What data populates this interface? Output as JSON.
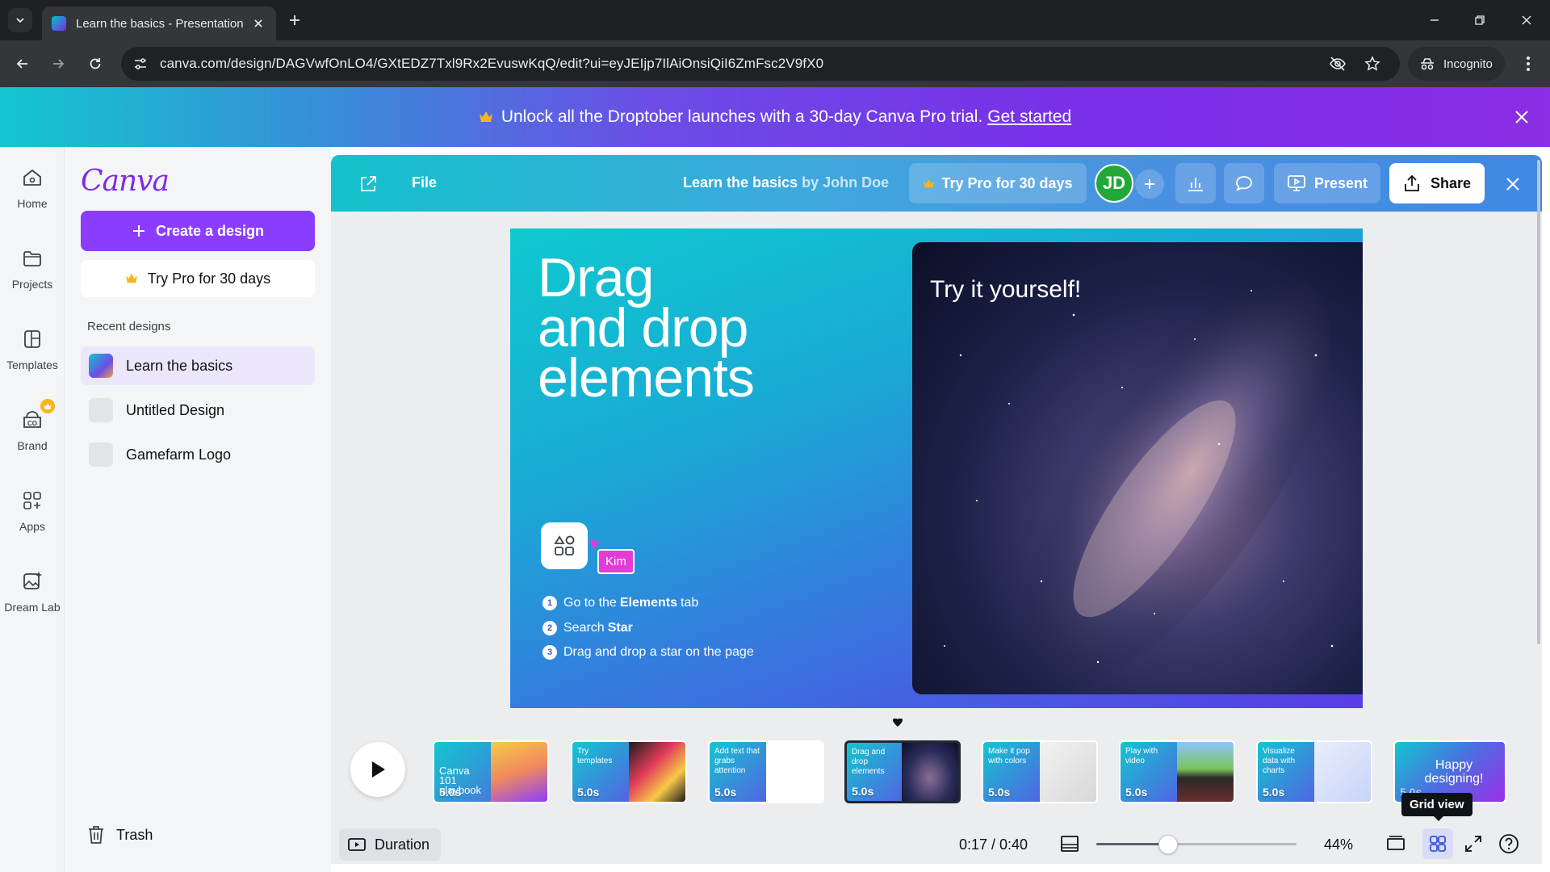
{
  "browser": {
    "tab_title": "Learn the basics - Presentation",
    "url": "canva.com/design/DAGVwfOnLO4/GXtEDZ7Txl9Rx2EvuswKqQ/edit?ui=eyJEIjp7IlAiOnsiQiI6ZmFsc2V9fX0",
    "incognito_label": "Incognito"
  },
  "banner": {
    "text": "Unlock all the Droptober launches with a 30-day Canva Pro trial.",
    "link": "Get started"
  },
  "rail": {
    "items": [
      {
        "label": "Home",
        "icon": "home-icon"
      },
      {
        "label": "Projects",
        "icon": "folder-icon"
      },
      {
        "label": "Templates",
        "icon": "templates-icon"
      },
      {
        "label": "Brand",
        "icon": "brand-icon"
      },
      {
        "label": "Apps",
        "icon": "apps-icon"
      },
      {
        "label": "Dream Lab",
        "icon": "dream-lab-icon"
      }
    ]
  },
  "panel": {
    "logo": "Canva",
    "create_label": "Create a design",
    "try_pro_label": "Try Pro for 30 days",
    "recent_title": "Recent designs",
    "recent": [
      "Learn the basics",
      "Untitled Design",
      "Gamefarm Logo"
    ],
    "trash_label": "Trash"
  },
  "editor": {
    "file_label": "File",
    "doc_title": "Learn the basics",
    "doc_by": "by John Doe",
    "try_pro_label": "Try Pro for 30 days",
    "avatar_initials": "JD",
    "present_label": "Present",
    "share_label": "Share"
  },
  "slide": {
    "title_lines": [
      "Drag",
      "and drop",
      "elements"
    ],
    "photo_caption": "Try it yourself!",
    "cursor_name": "Kim",
    "steps": [
      {
        "num": "1",
        "pre": "Go to the",
        "bold": "Elements",
        "post": "tab"
      },
      {
        "num": "2",
        "pre": "Search",
        "bold": "Star",
        "post": ""
      },
      {
        "num": "3",
        "pre": "Drag and drop a star on the page",
        "bold": "",
        "post": ""
      }
    ]
  },
  "timeline": {
    "thumbnails": [
      {
        "title": "Canva 101 playbook",
        "duration": "5.0s"
      },
      {
        "title": "Try templates",
        "duration": "5.0s"
      },
      {
        "title": "Add text that grabs attention",
        "duration": "5.0s"
      },
      {
        "title": "Drag and drop elements",
        "duration": "5.0s"
      },
      {
        "title": "Make it pop with colors",
        "duration": "5.0s"
      },
      {
        "title": "Play with video",
        "duration": "5.0s"
      },
      {
        "title": "Visualize data with charts",
        "duration": "5.0s"
      },
      {
        "title": "Happy designing!",
        "duration": "5.0s"
      }
    ],
    "selected_index": 3
  },
  "bottom": {
    "duration_label": "Duration",
    "time_readout": "0:17 / 0:40",
    "zoom_label": "44%",
    "zoom_fraction": 0.36,
    "grid_tooltip": "Grid view"
  },
  "colors": {
    "accent": "#8b3dff",
    "avatar": "#21a838",
    "cursor_tag": "#e33bd8"
  }
}
